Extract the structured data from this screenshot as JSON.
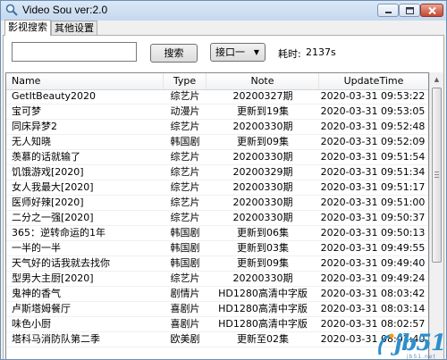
{
  "window": {
    "title": "Video Sou ver:2.0"
  },
  "tabs": [
    {
      "label": "影视搜索"
    },
    {
      "label": "其他设置"
    }
  ],
  "search": {
    "value": "",
    "placeholder": ""
  },
  "toolbar": {
    "search_label": "搜索",
    "api_selected": "接口一",
    "elapsed_label": "耗时:",
    "elapsed_value": "2137s"
  },
  "table": {
    "columns": [
      "Name",
      "Type",
      "Note",
      "UpdateTime"
    ],
    "rows": [
      [
        "GetItBeauty2020",
        "综艺片",
        "20200327期",
        "2020-03-31 09:53:22"
      ],
      [
        "宝可梦",
        "动漫片",
        "更新到19集",
        "2020-03-31 09:53:05"
      ],
      [
        "同床异梦2",
        "综艺片",
        "20200330期",
        "2020-03-31 09:52:48"
      ],
      [
        "无人知晓",
        "韩国剧",
        "更新到09集",
        "2020-03-31 09:52:09"
      ],
      [
        "羡慕的话就输了",
        "综艺片",
        "20200330期",
        "2020-03-31 09:51:54"
      ],
      [
        "饥饿游戏[2020]",
        "综艺片",
        "20200329期",
        "2020-03-31 09:51:34"
      ],
      [
        "女人我最大[2020]",
        "综艺片",
        "20200330期",
        "2020-03-31 09:51:17"
      ],
      [
        "医师好辣[2020]",
        "综艺片",
        "20200330期",
        "2020-03-31 09:51:00"
      ],
      [
        "二分之一强[2020]",
        "综艺片",
        "20200330期",
        "2020-03-31 09:50:37"
      ],
      [
        "365：逆转命运的1年",
        "韩国剧",
        "更新到06集",
        "2020-03-31 09:50:13"
      ],
      [
        "一半的一半",
        "韩国剧",
        "更新到03集",
        "2020-03-31 09:49:55"
      ],
      [
        "天气好的话我就去找你",
        "韩国剧",
        "更新到09集",
        "2020-03-31 09:49:40"
      ],
      [
        "型男大主厨[2020]",
        "综艺片",
        "20200330期",
        "2020-03-31 09:49:24"
      ],
      [
        "鬼神的香气",
        "剧情片",
        "HD1280高清中字版",
        "2020-03-31 08:03:42"
      ],
      [
        "卢斯塔姆餐厅",
        "喜剧片",
        "HD1280高清中字版",
        "2020-03-31 08:03:14"
      ],
      [
        "味色小厨",
        "喜剧片",
        "HD1280高清中字版",
        "2020-03-31 08:02:57"
      ],
      [
        "塔科马消防队第二季",
        "欧美剧",
        "更新至02集",
        "2020-03-31 08:02:40"
      ]
    ]
  },
  "watermark": {
    "text": "jb51",
    "sub": "jb51.net"
  },
  "colors": {
    "title_bar": "#c9dcf0",
    "watermark": "#2d8fcb",
    "close_button": "#c8472f"
  },
  "icons": {
    "app": "magnifier-icon",
    "minimize": "minimize-icon",
    "maximize": "maximize-icon",
    "close": "close-icon"
  }
}
